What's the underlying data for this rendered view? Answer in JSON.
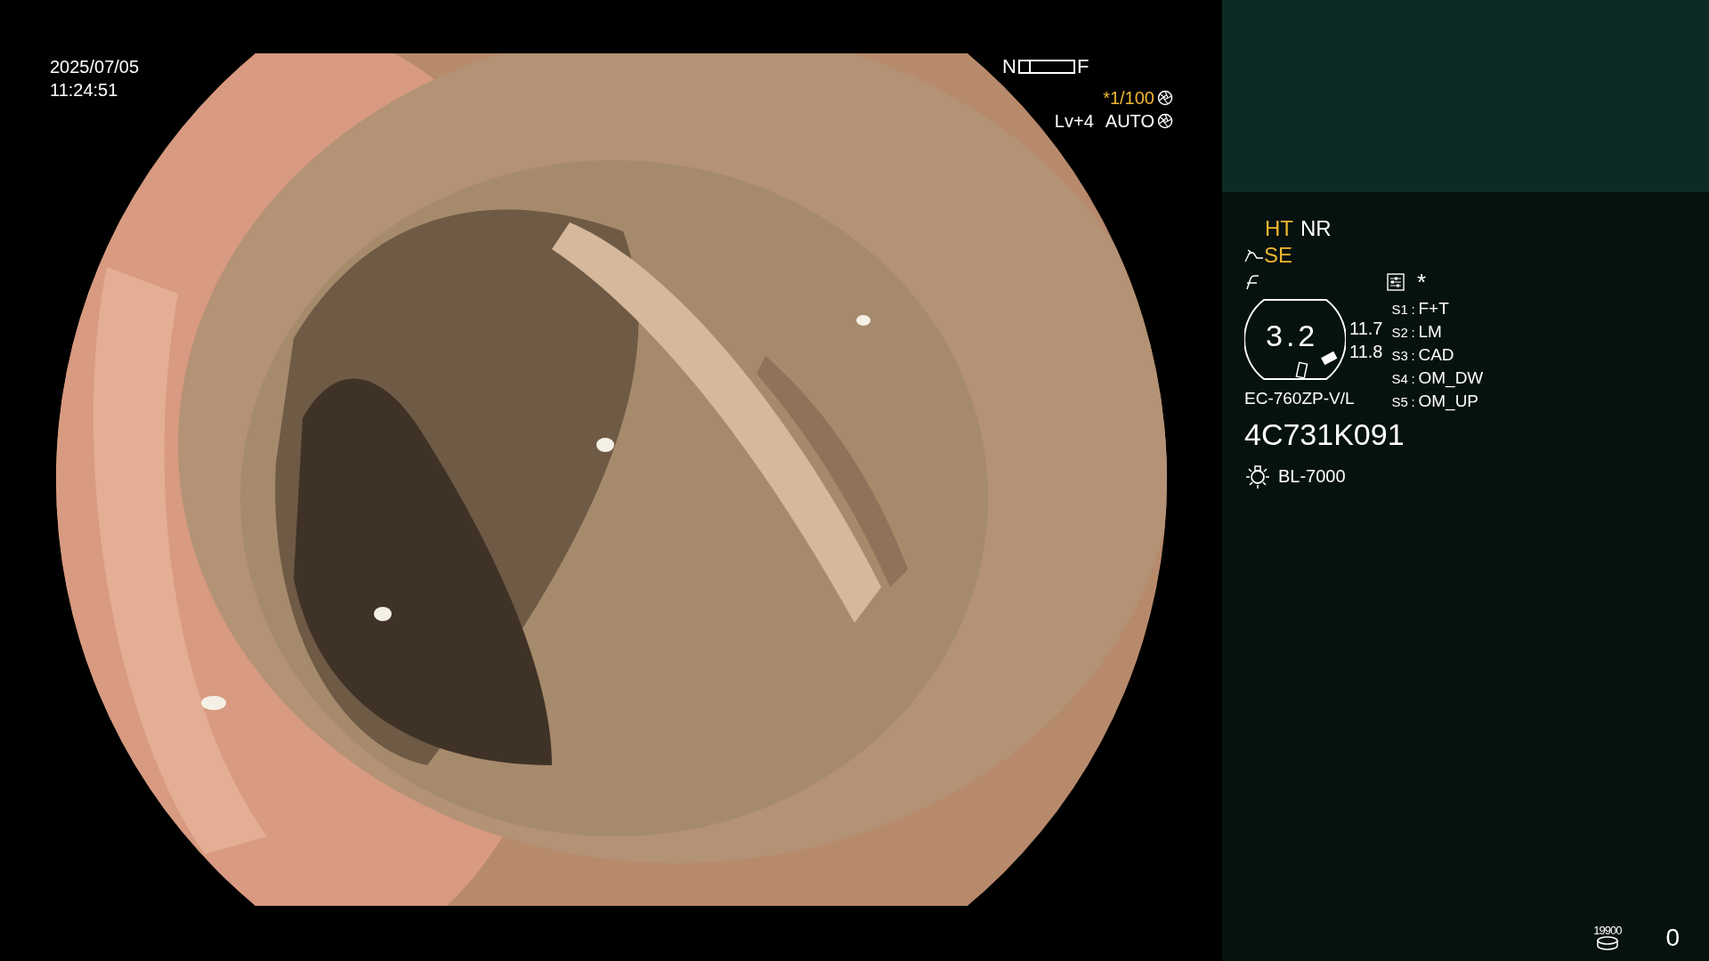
{
  "datetime": {
    "date": "2025/07/05",
    "time": "11:24:51"
  },
  "focus_indicator": {
    "near": "N",
    "far": "F",
    "level": 0.2
  },
  "shutter": {
    "value": "*1/100"
  },
  "iris": {
    "level": "Lv+4",
    "mode": "AUTO"
  },
  "panel": {
    "modes": [
      {
        "label": "HT",
        "active": true
      },
      {
        "label": "NR",
        "active": false
      }
    ],
    "enhancement": {
      "label": "SE",
      "active": true
    },
    "marker": "*",
    "zoom": "3.2",
    "readings": [
      "11.7",
      "11.8"
    ],
    "switches": [
      {
        "key": "S1",
        "sep": ":",
        "function": "F+T"
      },
      {
        "key": "S2",
        "sep": ":",
        "function": "LM"
      },
      {
        "key": "S3",
        "sep": ":",
        "function": "CAD"
      },
      {
        "key": "S4",
        "sep": ":",
        "function": "OM_DW"
      },
      {
        "key": "S5",
        "sep": ":",
        "function": "OM_UP"
      }
    ],
    "scope_model": "EC-760ZP-V/L",
    "serial": "4C731K091",
    "light_source": "BL-7000",
    "counter": "19900",
    "frame_count": "0"
  }
}
